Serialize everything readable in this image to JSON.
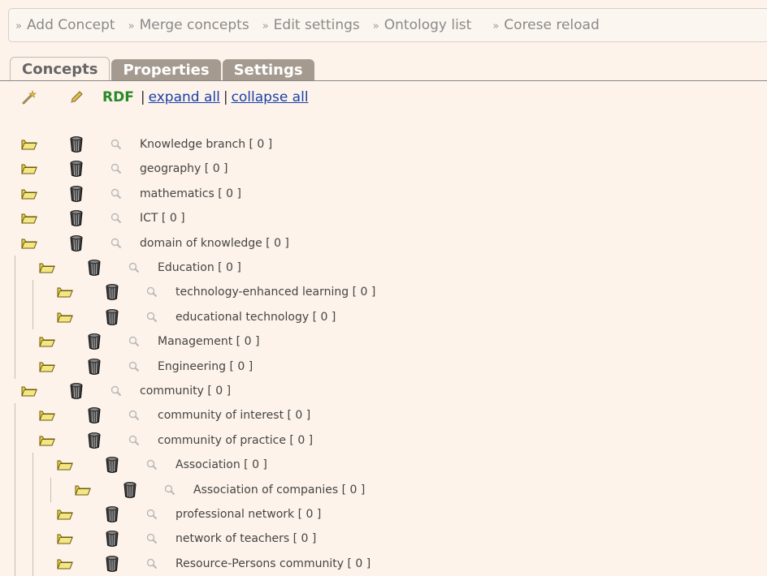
{
  "nav": {
    "arrow": "»",
    "items": [
      "Add Concept",
      "Merge concepts",
      "Edit settings",
      "Ontology list",
      "Corese reload"
    ]
  },
  "tabs": [
    "Concepts",
    "Properties",
    "Settings"
  ],
  "toolbar": {
    "rdf": "RDF",
    "sep": "|",
    "expand_all": "expand all",
    "collapse_all": "collapse all"
  },
  "tree": [
    {
      "label": "Knowledge branch [ 0 ]",
      "depth": 0
    },
    {
      "label": "geography [ 0 ]",
      "depth": 0
    },
    {
      "label": "mathematics [ 0 ]",
      "depth": 0
    },
    {
      "label": "ICT [ 0 ]",
      "depth": 0
    },
    {
      "label": "domain of knowledge [ 0 ]",
      "depth": 0
    },
    {
      "label": "Education [ 0 ]",
      "depth": 1
    },
    {
      "label": "technology-enhanced learning [ 0 ]",
      "depth": 2
    },
    {
      "label": "educational technology [ 0 ]",
      "depth": 2
    },
    {
      "label": "Management [ 0 ]",
      "depth": 1
    },
    {
      "label": "Engineering [ 0 ]",
      "depth": 1
    },
    {
      "label": "community [ 0 ]",
      "depth": 0
    },
    {
      "label": "community of interest [ 0 ]",
      "depth": 1
    },
    {
      "label": "community of practice [ 0 ]",
      "depth": 1
    },
    {
      "label": "Association [ 0 ]",
      "depth": 2
    },
    {
      "label": "Association of companies [ 0 ]",
      "depth": 3
    },
    {
      "label": "professional network [ 0 ]",
      "depth": 2
    },
    {
      "label": "network of teachers [ 0 ]",
      "depth": 2
    },
    {
      "label": "Resource-Persons community [ 0 ]",
      "depth": 2
    }
  ],
  "icons": {
    "folder": "folder-icon",
    "trash": "trash-icon",
    "magnifier": "magnifier-icon",
    "wand": "wand-icon",
    "pencil": "pencil-icon"
  }
}
